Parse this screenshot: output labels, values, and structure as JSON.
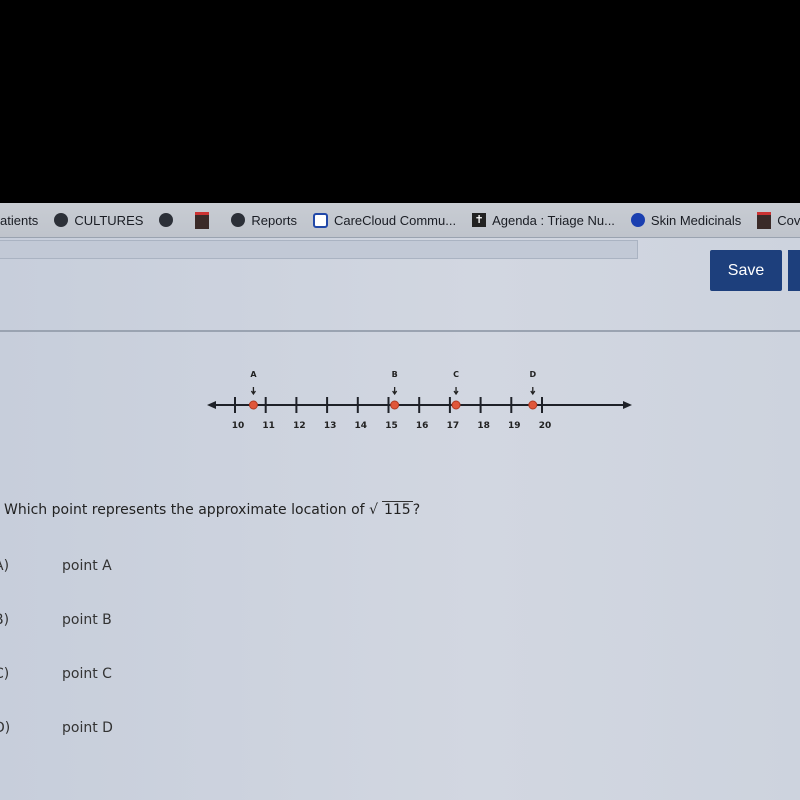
{
  "bookmarks": [
    {
      "label": "atients",
      "icon": "none"
    },
    {
      "label": "CULTURES",
      "icon": "globe-icon"
    },
    {
      "label": "",
      "icon": "globe-icon"
    },
    {
      "label": "",
      "icon": "arch-icon"
    },
    {
      "label": "Reports",
      "icon": "globe-icon"
    },
    {
      "label": "CareCloud Commu...",
      "icon": "cloud-icon"
    },
    {
      "label": "Agenda : Triage Nu...",
      "icon": "cross-icon"
    },
    {
      "label": "Skin Medicinals",
      "icon": "dot-icon"
    },
    {
      "label": "Cov",
      "icon": "arch-icon"
    }
  ],
  "toolbar": {
    "save_label": "Save"
  },
  "number_line": {
    "ticks": [
      10,
      11,
      12,
      13,
      14,
      15,
      16,
      17,
      18,
      19,
      20
    ],
    "points": [
      {
        "label": "A",
        "value": 10.6
      },
      {
        "label": "B",
        "value": 15.2
      },
      {
        "label": "C",
        "value": 17.2
      },
      {
        "label": "D",
        "value": 19.7
      }
    ],
    "point_color": "#e0573a"
  },
  "question": {
    "text": "Which point represents the approximate location of",
    "radicand": "115",
    "suffix": "?"
  },
  "choices": [
    {
      "letter": "A)",
      "text": "point A"
    },
    {
      "letter": "B)",
      "text": "point B"
    },
    {
      "letter": "C)",
      "text": "point C"
    },
    {
      "letter": "D)",
      "text": "point D"
    }
  ]
}
